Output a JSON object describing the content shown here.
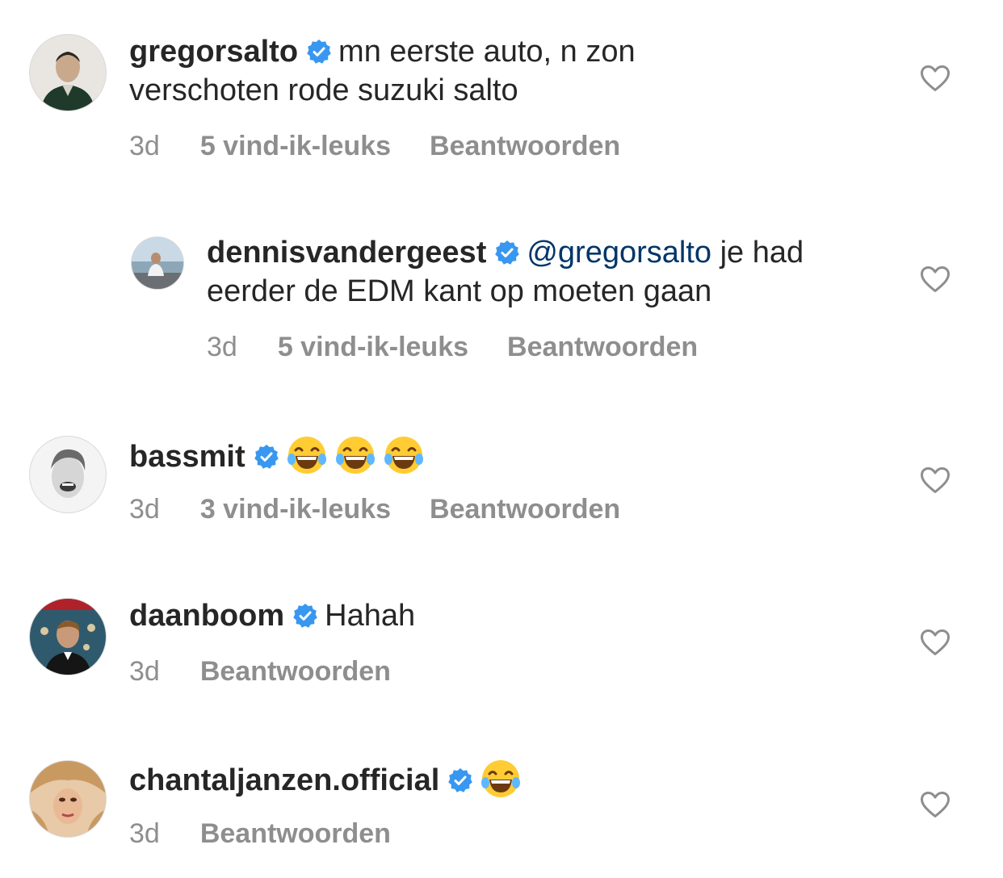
{
  "comments": [
    {
      "username": "gregorsalto",
      "verified": true,
      "text": "mn eerste auto, n zon verschoten rode suzuki salto",
      "time": "3d",
      "likes": "5 vind-ik-leuks",
      "reply": "Beantwoorden",
      "avatar": "profile-photo"
    },
    {
      "username": "dennisvandergeest",
      "verified": true,
      "mention": "@gregorsalto",
      "text": "je had eerder de EDM kant op moeten gaan",
      "time": "3d",
      "likes": "5 vind-ik-leuks",
      "reply": "Beantwoorden",
      "avatar": "profile-photo",
      "is_reply": true
    },
    {
      "username": "bassmit",
      "verified": true,
      "emoji": [
        "face-with-tears-of-joy",
        "face-with-tears-of-joy",
        "face-with-tears-of-joy"
      ],
      "time": "3d",
      "likes": "3 vind-ik-leuks",
      "reply": "Beantwoorden",
      "avatar": "profile-photo"
    },
    {
      "username": "daanboom",
      "verified": true,
      "text": "Hahah",
      "time": "3d",
      "reply": "Beantwoorden",
      "avatar": "profile-photo"
    },
    {
      "username": "chantaljanzen.official",
      "verified": true,
      "emoji": [
        "face-with-tears-of-joy"
      ],
      "time": "3d",
      "reply": "Beantwoorden",
      "avatar": "profile-photo"
    }
  ],
  "icons": {
    "verified": "verified-badge-icon",
    "like": "heart-outline-icon"
  },
  "colors": {
    "verified": "#3897f0",
    "mention": "#003569",
    "meta": "#8e8e8e",
    "text": "#262626"
  }
}
